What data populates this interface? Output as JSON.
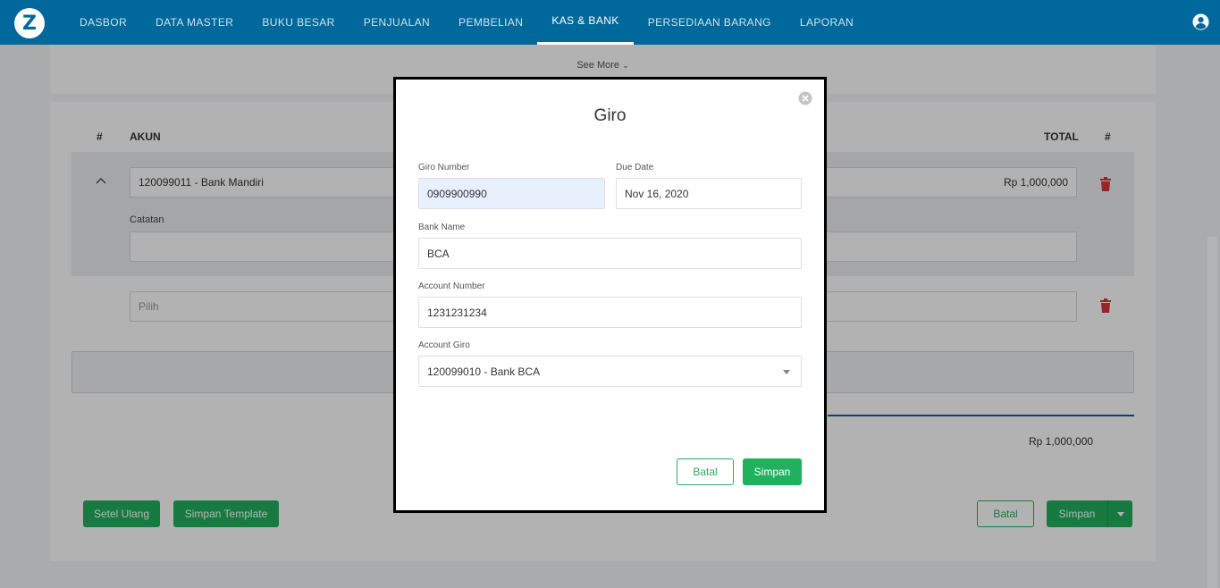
{
  "nav": {
    "logo_letter": "Z",
    "items": [
      {
        "label": "DASBOR"
      },
      {
        "label": "DATA MASTER"
      },
      {
        "label": "BUKU BESAR"
      },
      {
        "label": "PENJUALAN"
      },
      {
        "label": "PEMBELIAN"
      },
      {
        "label": "KAS & BANK"
      },
      {
        "label": "PERSEDIAAN BARANG"
      },
      {
        "label": "LAPORAN"
      }
    ],
    "active_index": 5
  },
  "page": {
    "see_more": "See More",
    "table": {
      "col_hash": "#",
      "col_akun": "AKUN",
      "col_total": "TOTAL",
      "col_hash2": "#"
    },
    "row1": {
      "account": "120099011 - Bank Mandiri",
      "amount": "Rp 1,000,000",
      "catatan_label": "Catatan"
    },
    "row2": {
      "placeholder": "Pilih"
    },
    "grand_total": "Rp 1,000,000",
    "buttons": {
      "reset": "Setel Ulang",
      "save_template": "Simpan Template",
      "cancel": "Batal",
      "save": "Simpan"
    }
  },
  "modal": {
    "title": "Giro",
    "giro_number_label": "Giro Number",
    "giro_number_value": "0909900990",
    "due_date_label": "Due Date",
    "due_date_value": "Nov 16, 2020",
    "bank_name_label": "Bank Name",
    "bank_name_value": "BCA",
    "account_number_label": "Account Number",
    "account_number_value": "1231231234",
    "account_giro_label": "Account Giro",
    "account_giro_value": "120099010 - Bank BCA",
    "cancel_label": "Batal",
    "save_label": "Simpan"
  },
  "colors": {
    "nav_bg": "#00689a",
    "accent_green": "#21b15e",
    "danger": "#d9363e"
  }
}
